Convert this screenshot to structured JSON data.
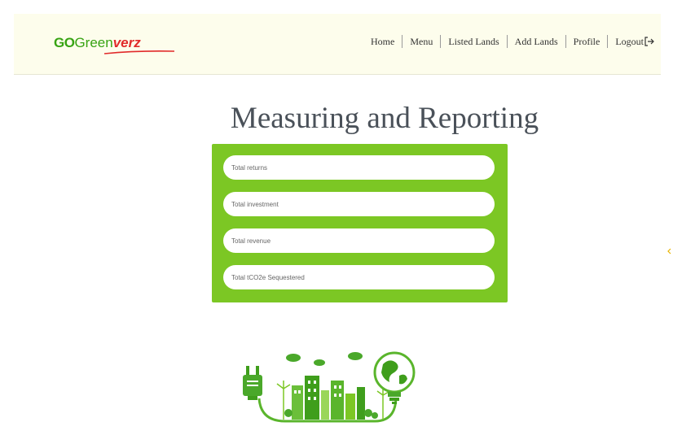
{
  "brand": {
    "logo_go": "GO",
    "logo_green": "Green",
    "logo_verz": "verz"
  },
  "nav": {
    "items": [
      "Home",
      "Menu",
      "Listed Lands",
      "Add Lands",
      "Profile"
    ],
    "logout": "Logout"
  },
  "page": {
    "title": "Measuring and Reporting"
  },
  "form": {
    "fields": [
      {
        "placeholder": "Total returns",
        "value": ""
      },
      {
        "placeholder": "Total investment",
        "value": ""
      },
      {
        "placeholder": "Total revenue",
        "value": ""
      },
      {
        "placeholder": "Total tCO2e Sequestered",
        "value": ""
      }
    ]
  },
  "colors": {
    "card_green": "#7cc724",
    "brand_green": "#37a313",
    "brand_red": "#e12a2a",
    "navbar_bg": "#fdfdec",
    "title_gray": "#4a5159"
  },
  "icons": {
    "logout": "logout-arrow-icon",
    "illustration": "eco-city-plug-bulb-illustration"
  }
}
